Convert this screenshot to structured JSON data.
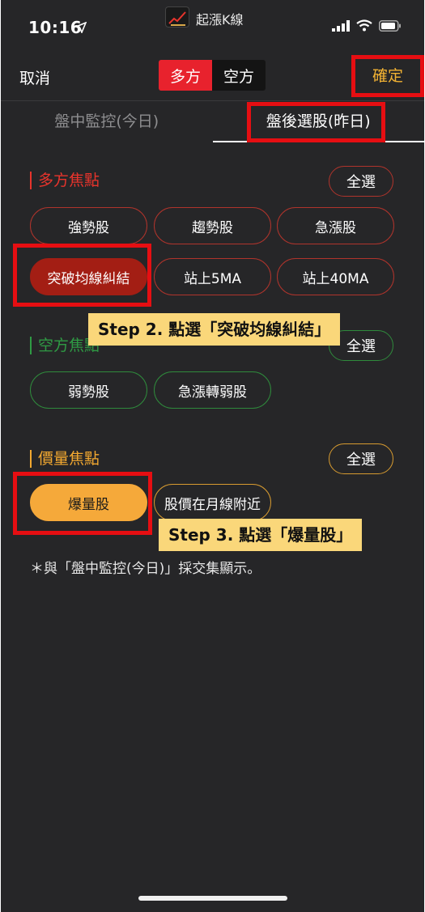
{
  "status_bar": {
    "time": "10:16",
    "app_name": "起漲K線"
  },
  "nav": {
    "cancel": "取消",
    "segment_long": "多方",
    "segment_short": "空方",
    "confirm": "確定"
  },
  "tabs": [
    {
      "label": "盤中監控(今日)",
      "active": false
    },
    {
      "label": "盤後選股(昨日)",
      "active": true
    }
  ],
  "sections": {
    "bull": {
      "title": "多方焦點",
      "select_all": "全選",
      "color": "#e8342c",
      "items": [
        "強勢股",
        "趨勢股",
        "急漲股",
        "突破均線糾結",
        "站上5MA",
        "站上40MA"
      ],
      "selected": "突破均線糾結"
    },
    "bear": {
      "title": "空方焦點",
      "select_all": "全選",
      "color": "#2f9a44",
      "items": [
        "弱勢股",
        "急漲轉弱股"
      ]
    },
    "volume": {
      "title": "價量焦點",
      "select_all": "全選",
      "color": "#f2a830",
      "items": [
        "爆量股",
        "股價在月線附近"
      ],
      "selected": "爆量股"
    }
  },
  "note": "＊與「盤中監控(今日)」採交集顯示。",
  "annotations": {
    "step2": "Step 2. 點選「突破均線糾結」",
    "step3": "Step 3. 點選「爆量股」"
  }
}
